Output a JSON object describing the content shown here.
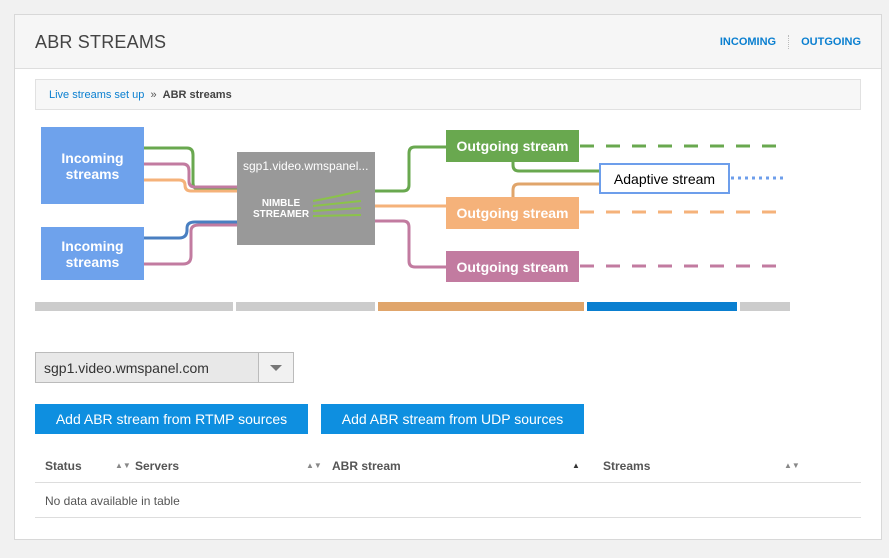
{
  "header": {
    "title": "ABR STREAMS",
    "links": [
      "INCOMING",
      "OUTGOING"
    ]
  },
  "breadcrumb": {
    "link": "Live streams set up",
    "separator": "»",
    "current": "ABR streams"
  },
  "diagram": {
    "incoming": [
      "Incoming",
      "streams"
    ],
    "server_name": "sgp1.video.wmspanel...",
    "logo_lines": [
      "NIMBLE",
      "STREAMER"
    ],
    "outgoing_label": "Outgoing stream",
    "adaptive_label": "Adaptive stream",
    "colors": {
      "incoming": "#6ea2ec",
      "server": "#999999",
      "green": "#69a84f",
      "orange": "#f5b27a",
      "pink": "#c27ba0",
      "adaptive": "#6d9eeb",
      "blue": "#4a7fc1",
      "bar_gray": "#cccccc",
      "bar_orange": "#e0a56b",
      "bar_blue": "#0a7fd0"
    }
  },
  "server_select": {
    "value": "sgp1.video.wmspanel.com"
  },
  "buttons": {
    "rtmp": "Add ABR stream from RTMP sources",
    "udp": "Add ABR stream from UDP sources"
  },
  "table": {
    "columns": [
      "Status",
      "Servers",
      "ABR stream",
      "Streams"
    ],
    "empty": "No data available in table"
  }
}
